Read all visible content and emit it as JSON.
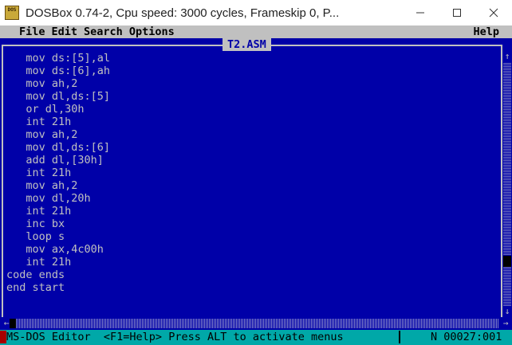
{
  "window": {
    "title": "DOSBox 0.74-2, Cpu speed:     3000 cycles, Frameskip  0, P...",
    "icon_text": "DOS BOX",
    "minimize_icon": "minimize-icon",
    "maximize_icon": "maximize-icon",
    "close_icon": "close-icon"
  },
  "menu": {
    "items": [
      "File",
      "Edit",
      "Search",
      "Options"
    ],
    "help": "Help"
  },
  "document": {
    "title": "T2.ASM",
    "lines": [
      "   mov ds:[5],al",
      "   mov ds:[6],ah",
      "   mov ah,2",
      "   mov dl,ds:[5]",
      "   or dl,30h",
      "   int 21h",
      "   mov ah,2",
      "   mov dl,ds:[6]",
      "   add dl,[30h]",
      "   int 21h",
      "   mov ah,2",
      "   mov dl,20h",
      "   int 21h",
      "   inc bx",
      "   loop s",
      "   mov ax,4c00h",
      "   int 21h",
      "code ends",
      "end start"
    ]
  },
  "statusbar": {
    "left": "MS-DOS Editor  <F1=Help> Press ALT to activate menus",
    "right": "N 00027:001"
  },
  "colors": {
    "editor_bg": "#0000a8",
    "editor_fg": "#c0c0c0",
    "status_bg": "#00a8a8"
  }
}
